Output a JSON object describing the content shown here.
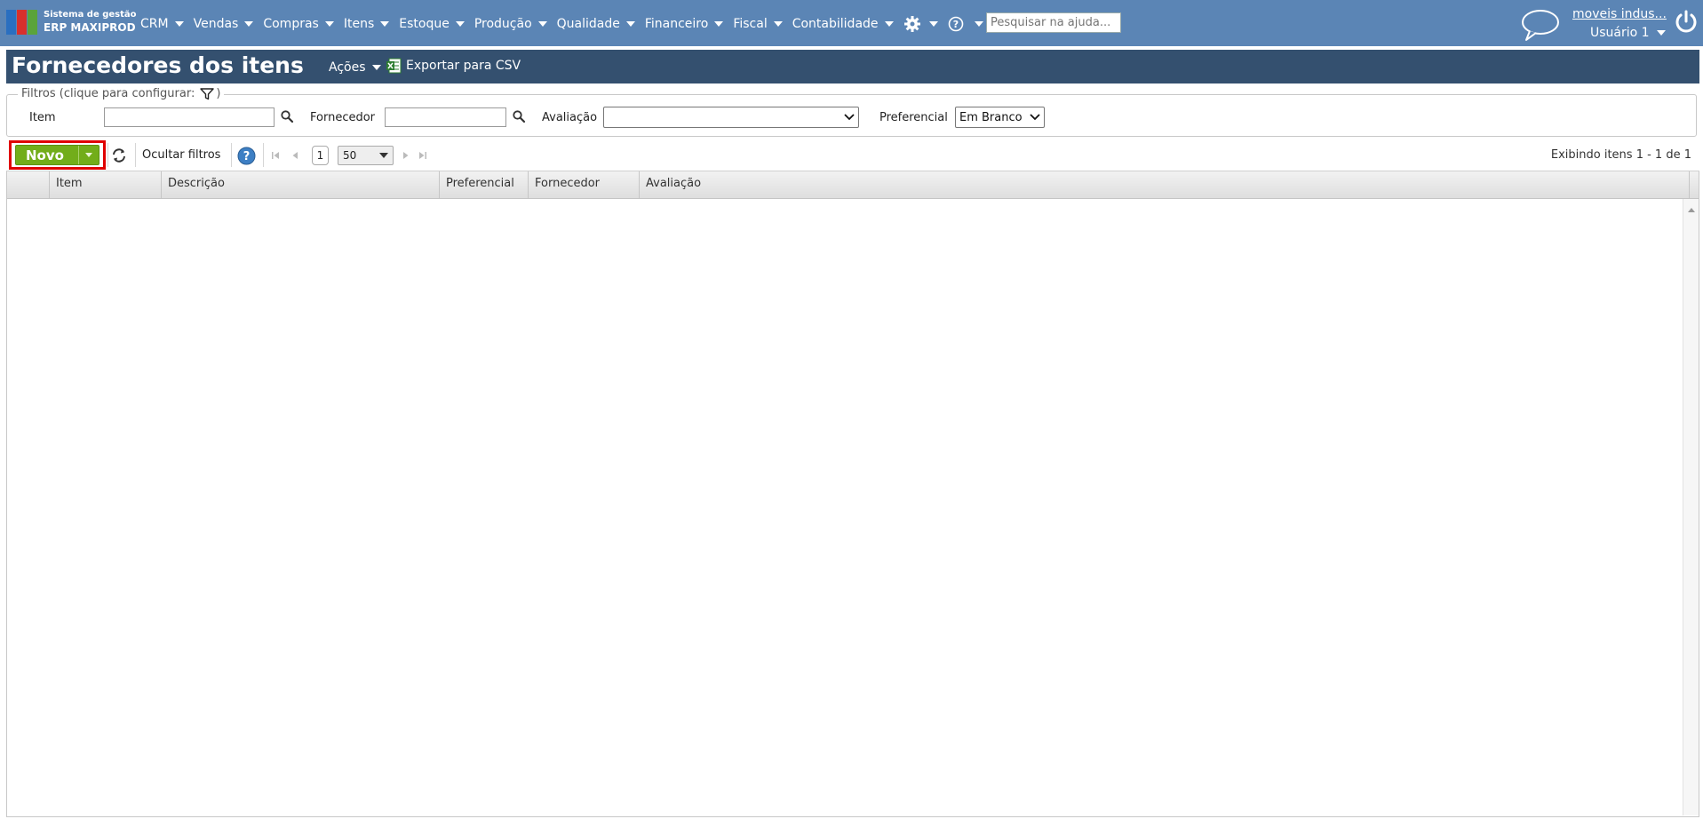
{
  "app": {
    "brand_line1": "Sistema de gestão",
    "brand_line2": "ERP MAXIPROD"
  },
  "nav": {
    "items": [
      {
        "label": "CRM"
      },
      {
        "label": "Vendas"
      },
      {
        "label": "Compras"
      },
      {
        "label": "Itens"
      },
      {
        "label": "Estoque"
      },
      {
        "label": "Produção"
      },
      {
        "label": "Qualidade"
      },
      {
        "label": "Financeiro"
      },
      {
        "label": "Fiscal"
      },
      {
        "label": "Contabilidade"
      }
    ],
    "icons": [
      "gear-icon",
      "question-icon",
      "chat-icon",
      "power-icon"
    ],
    "help_search_placeholder": "Pesquisar na ajuda...",
    "company_name": "moveis indus...",
    "user_name": "Usuário 1"
  },
  "page": {
    "title": "Fornecedores dos itens",
    "actions_label": "Ações",
    "export_label": "Exportar para CSV"
  },
  "filters": {
    "legend_prefix": "Filtros (clique para configurar:",
    "legend_suffix": ")",
    "item_label": "Item",
    "item_value": "",
    "supplier_label": "Fornecedor",
    "supplier_value": "",
    "rating_label": "Avaliação",
    "rating_value": "",
    "preferred_label": "Preferencial",
    "preferred_value": "Em Branco"
  },
  "toolbar": {
    "new_label": "Novo",
    "hide_filters_label": "Ocultar filtros",
    "current_page": "1",
    "page_size": "50",
    "showing_info": "Exibindo itens 1 - 1 de 1"
  },
  "grid": {
    "columns": [
      "Item",
      "Descrição",
      "Preferencial",
      "Fornecedor",
      "Avaliação"
    ],
    "rows": []
  },
  "colors": {
    "topbar": "#5b85b5",
    "header_band": "#34506f",
    "new_button": "#72ad1a",
    "highlight": "#e00000"
  }
}
